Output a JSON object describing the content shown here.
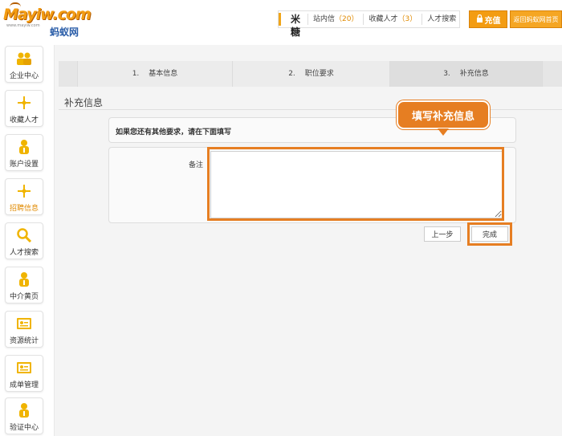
{
  "logo": {
    "brand": "Mayiw.com",
    "sub": "www.mayiw.com",
    "cn": "蚂蚁网"
  },
  "header": {
    "user": "米糖",
    "links": [
      {
        "label": "站内信",
        "count": "（20）"
      },
      {
        "label": "收藏人才",
        "count": "（3）"
      },
      {
        "label": "人才搜索",
        "count": ""
      }
    ],
    "recharge_label": "充值",
    "home_label": "返回蚂蚁网首页"
  },
  "sidebar": {
    "items": [
      {
        "label": "企业中心",
        "icon": "people-icon"
      },
      {
        "label": "收藏人才",
        "icon": "sparkle-icon"
      },
      {
        "label": "账户设置",
        "icon": "person-icon"
      },
      {
        "label": "招聘信息",
        "icon": "sparkle-icon",
        "active": true
      },
      {
        "label": "人才搜索",
        "icon": "search-icon"
      },
      {
        "label": "中介黄页",
        "icon": "person-icon"
      },
      {
        "label": "资源统计",
        "icon": "card-icon"
      },
      {
        "label": "成单管理",
        "icon": "card-icon"
      },
      {
        "label": "验证中心",
        "icon": "person-icon"
      }
    ]
  },
  "steps": [
    {
      "num": "1.",
      "label": "基本信息"
    },
    {
      "num": "2.",
      "label": "职位要求"
    },
    {
      "num": "3.",
      "label": "补充信息",
      "current": true
    }
  ],
  "section_title": "补充信息",
  "note": "如果您还有其他要求，请在下面填写",
  "form": {
    "remark_label": "备注",
    "remark_value": ""
  },
  "buttons": {
    "prev": "上一步",
    "finish": "完成"
  },
  "callout": "填写补充信息",
  "colors": {
    "accent": "#f39c12",
    "highlight": "#e67e22",
    "link_count": "#e08a00"
  }
}
